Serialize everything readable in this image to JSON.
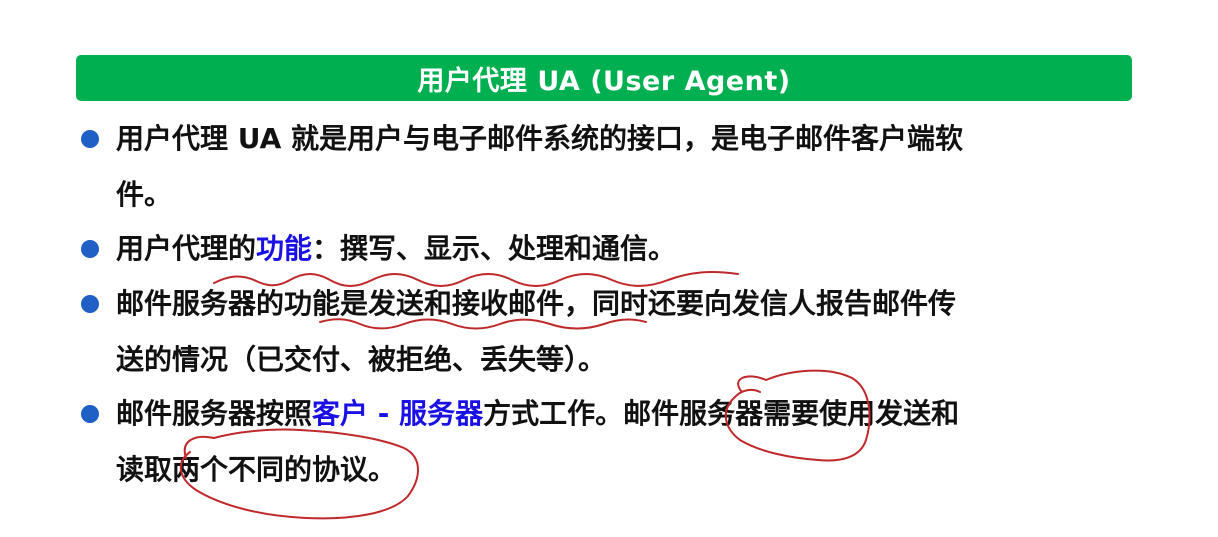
{
  "header": {
    "title": "用户代理 UA (User Agent)",
    "background_color": "#00b050"
  },
  "bullet_color": "#1f5fc6",
  "highlight_color": "#1a10e6",
  "annotation_color": "#c0292b",
  "bullets": [
    {
      "lines": [
        {
          "text": "用户代理 UA 就是用户与电子邮件系统的接口，是电子邮件客户端软"
        },
        {
          "text": "件。"
        }
      ]
    },
    {
      "lines": [
        {
          "before": "用户代理的",
          "highlight": "功能",
          "after": "：撰写、显示、处理和通信。"
        }
      ]
    },
    {
      "lines": [
        {
          "text": "邮件服务器的功能是发送和接收邮件，同时还要向发信人报告邮件传"
        },
        {
          "text": "送的情况（已交付、被拒绝、丢失等）。"
        }
      ]
    },
    {
      "lines": [
        {
          "before": "邮件服务器按照",
          "highlight": "客户 - 服务器",
          "after": "方式工作。邮件服务器需要使用发送和"
        },
        {
          "text": "读取两个不同的协议。"
        }
      ]
    }
  ]
}
